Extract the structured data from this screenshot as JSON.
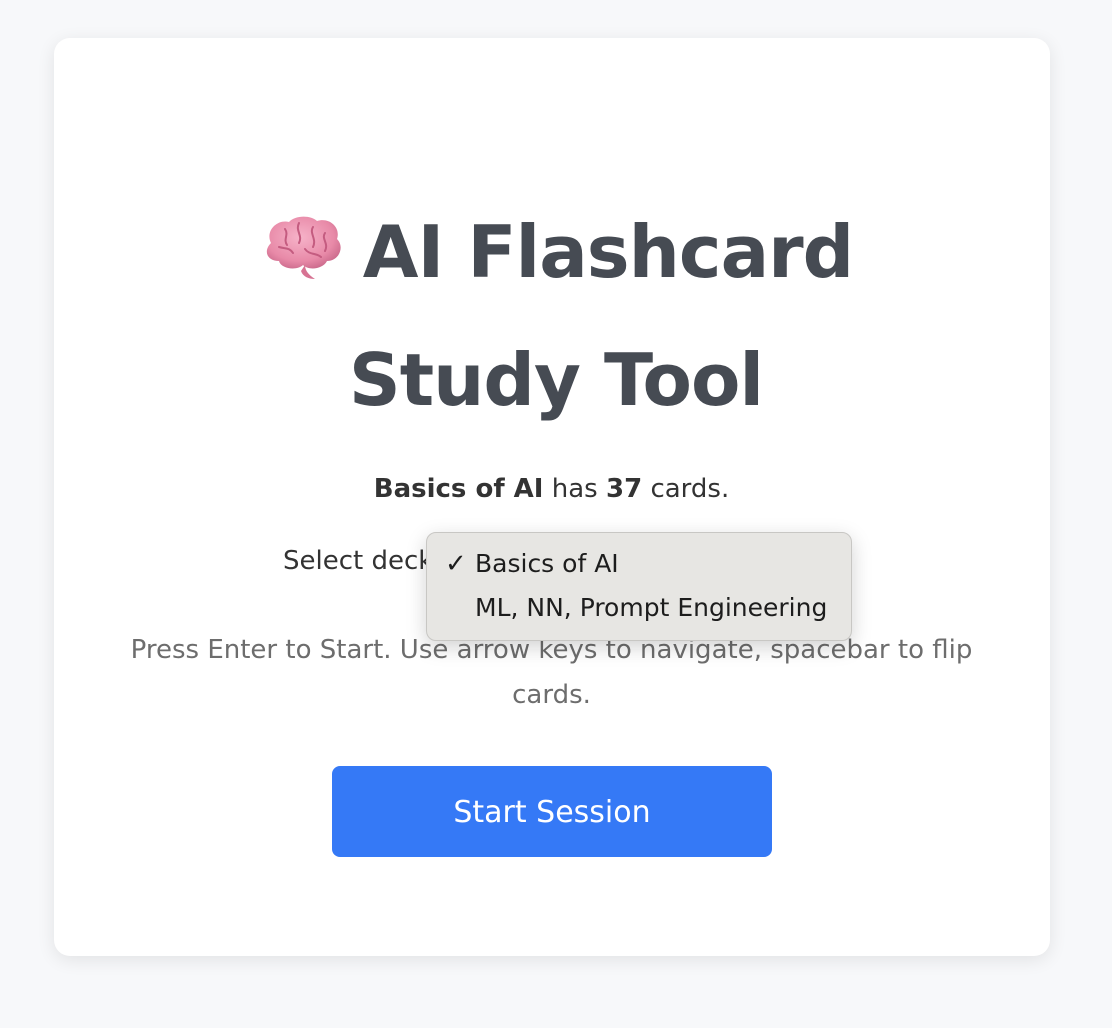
{
  "title": {
    "icon": "brain-icon",
    "line1": "AI Flashcard",
    "line2": "Study Tool"
  },
  "deck_info": {
    "deck_name": "Basics of AI",
    "has": "has",
    "count": "37",
    "suffix": "cards."
  },
  "deck_select": {
    "label": "Select deck",
    "options": [
      {
        "label": "Basics of AI",
        "selected": true
      },
      {
        "label": "ML, NN, Prompt Engineering",
        "selected": false
      }
    ],
    "check_mark": "✓"
  },
  "help_text": "Press Enter to Start. Use arrow keys to navigate, spacebar to flip cards.",
  "start_button": {
    "label": "Start Session"
  },
  "colors": {
    "accent": "#3579f6",
    "title": "#464b53",
    "background": "#f7f8fa",
    "dropdown_bg": "#e7e6e3"
  }
}
